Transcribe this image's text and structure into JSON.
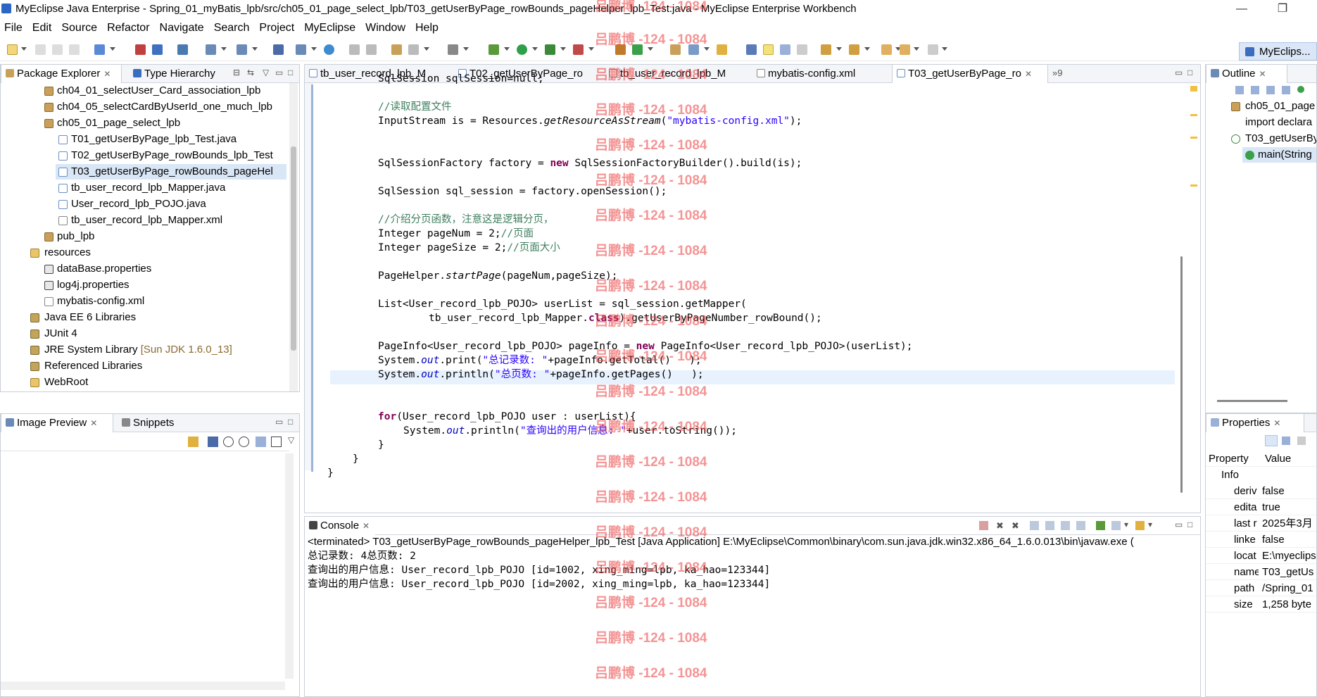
{
  "window": {
    "title": "MyEclipse Java Enterprise - Spring_01_myBatis_lpb/src/ch05_01_page_select_lpb/T03_getUserByPage_rowBounds_pageHelper_lpb_Test.java - MyEclipse Enterprise Workbench",
    "minimize": "—",
    "restore": "❐"
  },
  "menu": [
    "File",
    "Edit",
    "Source",
    "Refactor",
    "Navigate",
    "Search",
    "Project",
    "MyEclipse",
    "Window",
    "Help"
  ],
  "perspective": "MyEclips...",
  "package_explorer": {
    "tabs": [
      "Package Explorer",
      "Type Hierarchy"
    ],
    "items": [
      "ch04_01_selectUser_Card_association_lpb",
      "ch04_05_selectCardByUserId_one_much_lpb",
      "ch05_01_page_select_lpb",
      "T01_getUserByPage_lpb_Test.java",
      "T02_getUserByPage_rowBounds_lpb_Test",
      "T03_getUserByPage_rowBounds_pageHel",
      "tb_user_record_lpb_Mapper.java",
      "User_record_lpb_POJO.java",
      "tb_user_record_lpb_Mapper.xml",
      "pub_lpb",
      "resources",
      "dataBase.properties",
      "log4j.properties",
      "mybatis-config.xml",
      "Java EE 6 Libraries",
      "JUnit 4",
      "JRE System Library",
      "Referenced Libraries",
      "WebRoot"
    ],
    "jre_suffix": "[Sun JDK 1.6.0_13]"
  },
  "bottom_left": {
    "tabs": [
      "Image Preview",
      "Snippets"
    ]
  },
  "editor": {
    "tabs": [
      "tb_user_record_lpb_M",
      "T02_getUserByPage_ro",
      "tb_user_record_lpb_M",
      "mybatis-config.xml",
      "T03_getUserByPage_ro"
    ],
    "overflow": "»9",
    "code": {
      "l0": "SqlSession sqlSession=null;",
      "l1": "//读取配置文件",
      "l2a": "InputStream is = Resources.",
      "l2b": "getResourceAsStream",
      "l2c": "(",
      "l2d": "\"mybatis-config.xml\"",
      "l2e": ");",
      "l3a": "SqlSessionFactory factory = ",
      "l3b": "new",
      "l3c": " SqlSessionFactoryBuilder().build(is);",
      "l4": "SqlSession sql_session = factory.openSession();",
      "l5": "//介绍分页函数，注意这是逻辑分页，",
      "l6a": "Integer pageNum = 2;",
      "l6b": "//页面",
      "l7a": "Integer pageSize = 2;",
      "l7b": "//页面大小",
      "l8a": "PageHelper.",
      "l8b": "startPage",
      "l8c": "(pageNum,pageSize);",
      "l9": "List<User_record_lpb_POJO> userList = sql_session.getMapper(",
      "l10a": "tb_user_record_lpb_Mapper.",
      "l10b": "class",
      "l10c": ").getUserByPageNumber_rowBound();",
      "l11a": "PageInfo<User_record_lpb_POJO> pageInfo = ",
      "l11b": "new",
      "l11c": " PageInfo<User_record_lpb_POJO>(userList);",
      "l12a": "System.",
      "l12b": "out",
      "l12c": ".print(",
      "l12d": "\"总记录数: \"",
      "l12e": "+pageInfo.getTotal()   );",
      "l13a": "System.",
      "l13b": "out",
      "l13c": ".println(",
      "l13d": "\"总页数: \"",
      "l13e": "+pageInfo.getPages()   );",
      "l14a": "for",
      "l14b": "(User_record_lpb_POJO user : userList){",
      "l15a": "System.",
      "l15b": "out",
      "l15c": ".println(",
      "l15d": "\"查询出的用户信息: \"",
      "l15e": "+user.toString());",
      "l16": "}",
      "l17": "}",
      "l18": "}"
    }
  },
  "console": {
    "tab": "Console",
    "header": "<terminated> T03_getUserByPage_rowBounds_pageHelper_lpb_Test [Java Application] E:\\MyEclipse\\Common\\binary\\com.sun.java.jdk.win32.x86_64_1.6.0.013\\bin\\javaw.exe (",
    "lines": [
      "总记录数: 4总页数: 2",
      "查询出的用户信息: User_record_lpb_POJO [id=1002, xing_ming=lpb, ka_hao=123344]",
      "查询出的用户信息: User_record_lpb_POJO [id=2002, xing_ming=lpb, ka_hao=123344]"
    ]
  },
  "outline": {
    "tab": "Outline",
    "items": [
      "ch05_01_page",
      "import declara",
      "T03_getUserBy",
      "main(String"
    ]
  },
  "properties": {
    "tab": "Properties",
    "header": {
      "property": "Property",
      "value": "Value"
    },
    "group": "Info",
    "rows": [
      {
        "key": "deriv",
        "value": "false"
      },
      {
        "key": "edita",
        "value": "true"
      },
      {
        "key": "last r",
        "value": "2025年3月"
      },
      {
        "key": "linke",
        "value": "false"
      },
      {
        "key": "locat",
        "value": "E:\\myeclips"
      },
      {
        "key": "name",
        "value": "T03_getUs"
      },
      {
        "key": "path",
        "value": "/Spring_01"
      },
      {
        "key": "size",
        "value": "1,258 byte"
      }
    ]
  },
  "watermark": "吕鹏博 -124 - 1084",
  "colors": {
    "keyword": "#7f0055",
    "comment": "#3f7f5f",
    "string": "#2a00ff",
    "field": "#0000c0",
    "selection": "#d9e6f6"
  }
}
